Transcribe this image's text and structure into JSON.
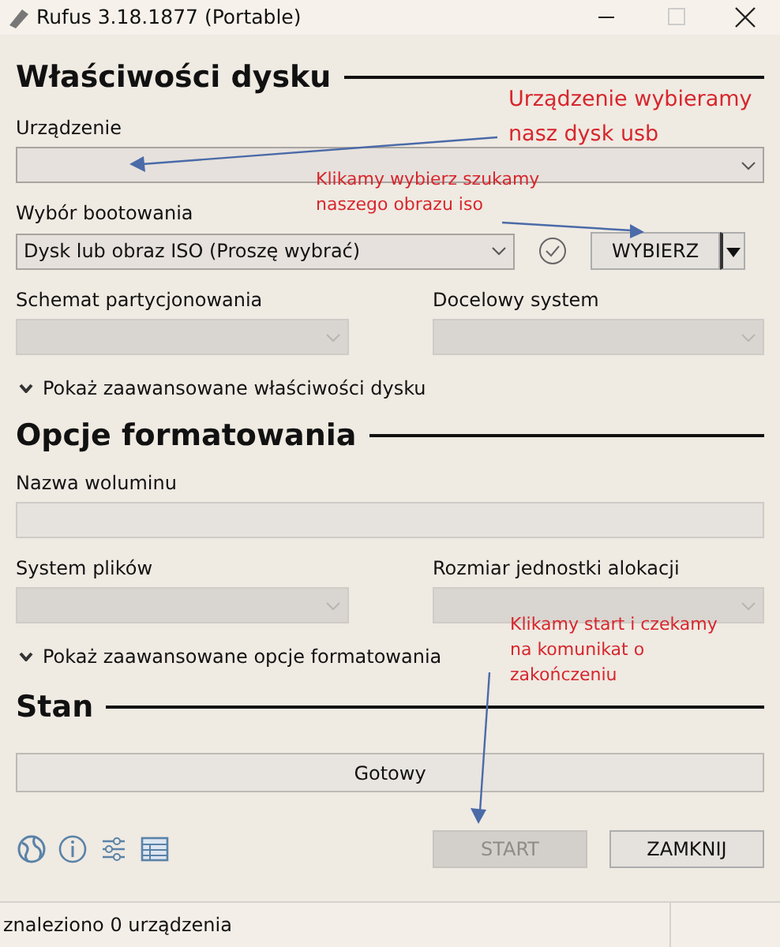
{
  "window": {
    "title": "Rufus 3.18.1877 (Portable)"
  },
  "drive_properties": {
    "heading": "Właściwości dysku",
    "device": {
      "label": "Urządzenie",
      "disabled": false
    },
    "boot": {
      "label": "Wybór bootowania",
      "value": "Dysk lub obraz ISO (Proszę wybrać)",
      "disabled": false,
      "select_button": "WYBIERZ"
    },
    "pairs": [
      {
        "label": "Schemat partycjonowania",
        "disabled": true
      },
      {
        "label": "Docelowy system",
        "disabled": true
      }
    ],
    "expander": {
      "label": "Pokaż zaawansowane właściwości dysku",
      "expanded": false
    }
  },
  "format_options": {
    "heading": "Opcje formatowania",
    "volume": {
      "label": "Nazwa woluminu",
      "disabled": true
    },
    "pairs": [
      {
        "label": "System plików",
        "disabled": true
      },
      {
        "label": "Rozmiar jednostki alokacji",
        "disabled": true
      }
    ],
    "expander": {
      "label": "Pokaż zaawansowane opcje formatowania",
      "expanded": false
    }
  },
  "status": {
    "heading": "Stan",
    "progress_text": "Gotowy",
    "level": 0
  },
  "toolbar": {
    "buttons": [
      {
        "label": "START",
        "disabled": true
      },
      {
        "label": "ZAMKNIJ",
        "disabled": false
      }
    ]
  },
  "status_bar": "znaleziono 0 urządzenia",
  "annotations": [
    {
      "lines": [
        "Urządzenie wybieramy",
        "nasz dysk usb"
      ]
    },
    {
      "lines": [
        "Klikamy wybierz szukamy",
        "naszego obrazu iso"
      ]
    },
    {
      "lines": [
        "Klikamy start i czekamy",
        "na komunikat o",
        "zakończeniu"
      ]
    }
  ]
}
